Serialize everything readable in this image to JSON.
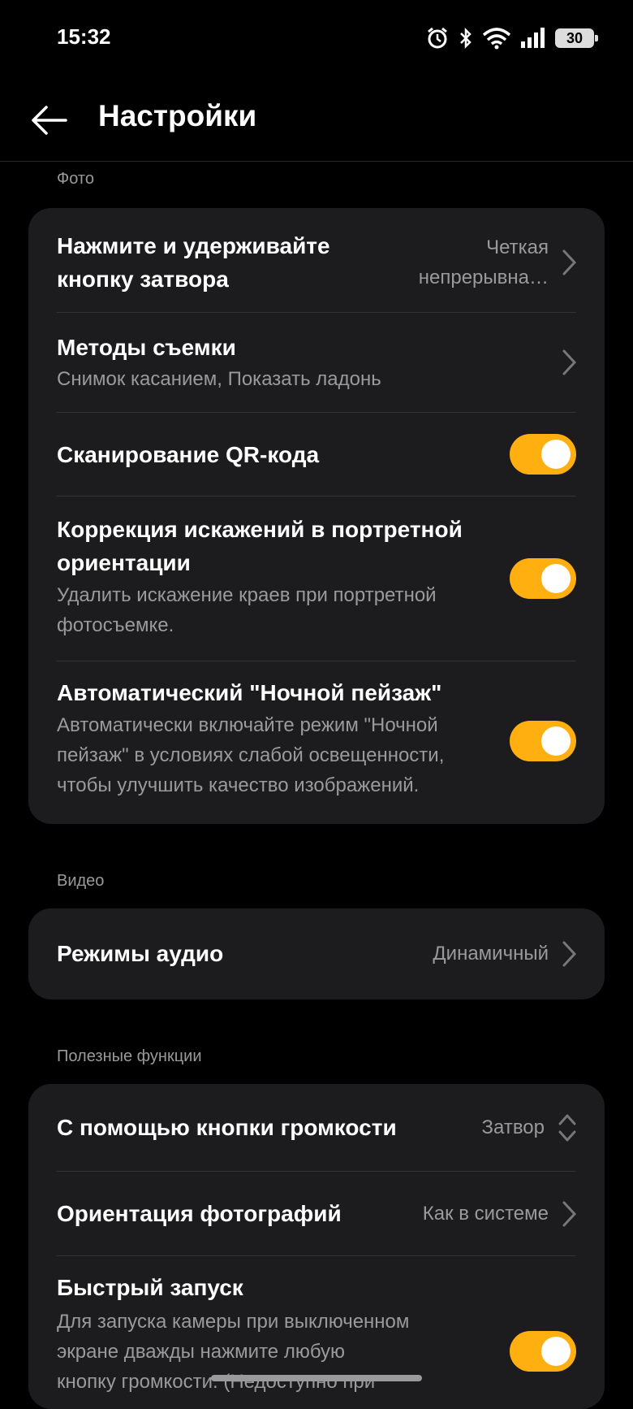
{
  "status_bar": {
    "time": "15:32",
    "battery": "30"
  },
  "header": {
    "title": "Настройки"
  },
  "sections": {
    "photo": {
      "label": "Фото",
      "shutter": {
        "title_line1": "Нажмите и удерживайте",
        "title_line2": "кнопку затвора",
        "value_line1": "Четкая",
        "value_line2": "непрерывна…"
      },
      "methods": {
        "title": "Методы съемки",
        "subtitle": "Снимок касанием, Показать ладонь"
      },
      "qr": {
        "title": "Сканирование QR-кода",
        "enabled": true
      },
      "distortion": {
        "title_line1": "Коррекция искажений в портретной",
        "title_line2": "ориентации",
        "sub_line1": "Удалить искажение краев при портретной",
        "sub_line2": "фотосъемке.",
        "enabled": true
      },
      "night": {
        "title": "Автоматический \"Ночной пейзаж\"",
        "sub_line1": "Автоматически включайте режим \"Ночной",
        "sub_line2": "пейзаж\" в условиях слабой освещенности,",
        "sub_line3": "чтобы улучшить качество изображений.",
        "enabled": true
      }
    },
    "video": {
      "label": "Видео",
      "audio": {
        "title": "Режимы аудио",
        "value": "Динамичный"
      }
    },
    "useful": {
      "label": "Полезные функции",
      "volume": {
        "title": "С помощью кнопки громкости",
        "value": "Затвор"
      },
      "orientation": {
        "title": "Ориентация фотографий",
        "value": "Как в системе"
      },
      "quick": {
        "title": "Быстрый запуск",
        "sub_line1": "Для запуска камеры при выключенном",
        "sub_line2": "экране дважды нажмите любую",
        "sub_line3": "кнопку громкости. (Недоступно при",
        "enabled": true
      }
    }
  },
  "colors": {
    "accent": "#ffaf10",
    "card": "#1c1c1e",
    "background": "#000000",
    "secondary_text": "#9a9a9a"
  }
}
